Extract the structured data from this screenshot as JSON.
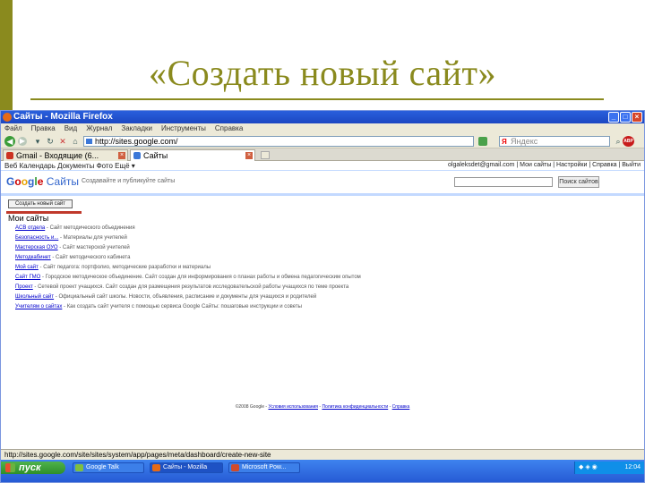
{
  "slide": {
    "title": "«Создать новый сайт»"
  },
  "browser": {
    "window_title": "Сайты - Mozilla Firefox",
    "menu": [
      "Файл",
      "Правка",
      "Вид",
      "Журнал",
      "Закладки",
      "Инструменты",
      "Справка"
    ],
    "url": "http://sites.google.com/",
    "search_placeholder": "Яндекс",
    "search_engine_logo": "Я",
    "adblock_label": "ABP",
    "tabs": [
      {
        "label": "Gmail - Входящие (6...",
        "icon_color": "#cc3322"
      },
      {
        "label": "Сайты",
        "icon_color": "#3c78d8"
      }
    ],
    "status_text": "http://sites.google.com/site/sites/system/app/pages/meta/dashboard/create-new-site"
  },
  "google_bar": {
    "left": "Веб  Календарь  Документы  Фото  Ещё ▾",
    "right": "olgaleksdet@gmail.com | Мои сайты | Настройки | Справка | Выйти"
  },
  "header": {
    "logo_letters": [
      "G",
      "o",
      "o",
      "g",
      "l",
      "e"
    ],
    "service_name": "Сайты",
    "subtitle": "Создавайте и публикуйте сайты",
    "search_button": "Поиск сайтов"
  },
  "main": {
    "create_button": "Создать новый сайт",
    "my_sites_title": "Мои сайты",
    "sites": [
      {
        "name": "ACB отдела",
        "desc": " - Сайт методического объединения"
      },
      {
        "name": "Безопасность и...",
        "desc": " - Материалы для учителей"
      },
      {
        "name": "Мастерская ОУО",
        "desc": " - Сайт мастерской учителей"
      },
      {
        "name": "Методкабинет",
        "desc": " - Сайт методического кабинета"
      },
      {
        "name": "Мой сайт",
        "desc": " - Сайт педагога: портфолио, методические разработки и материалы"
      },
      {
        "name": "Сайт ГМО",
        "desc": " - Городское методическое объединение. Сайт создан для информирования о планах работы и обмена педагогическим опытом"
      },
      {
        "name": "Проект",
        "desc": " - Сетевой проект учащихся. Сайт создан для размещения результатов исследовательской работы учащихся по теме проекта"
      },
      {
        "name": "Школьный сайт",
        "desc": " - Официальный сайт школы. Новости, объявления, расписание и документы для учащихся и родителей"
      },
      {
        "name": "Учителям о сайтах",
        "desc": " - Как создать сайт учителя с помощью сервиса Google Сайты: пошаговые инструкции и советы"
      }
    ],
    "footer_copy": "©2008 Google - ",
    "footer_links": [
      "Условия использования",
      "Политика конфиденциальности",
      "Справка"
    ]
  },
  "taskbar": {
    "start_label": "пуск",
    "tasks": [
      {
        "label": "Google Talk",
        "icon_color": "#7fbf3f"
      },
      {
        "label": "Сайты - Mozilla",
        "icon_color": "#e66a16"
      },
      {
        "label": "Microsoft Pow...",
        "icon_color": "#d04a2a"
      }
    ],
    "clock": "12:04"
  }
}
